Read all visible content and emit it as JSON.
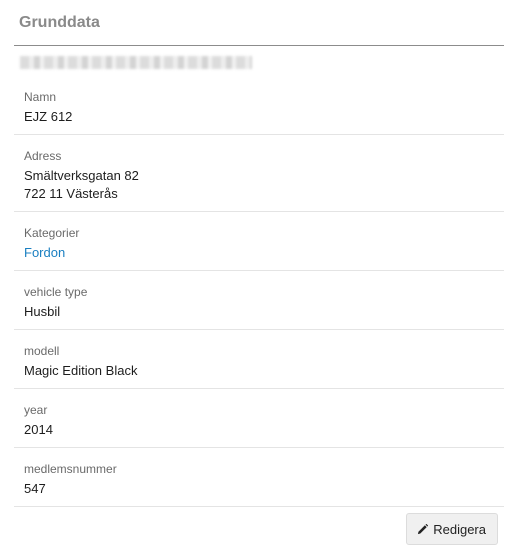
{
  "panel": {
    "title": "Grunddata",
    "blurred_text": "▇▇▇▇▇▇▇▇▇▇▇▇▇▇▇▇▇▇▇▇▇▇▇▇▇▇▇▇▇▇▇▇▇▇▇▇"
  },
  "fields": [
    {
      "label": "Namn",
      "values": [
        "EJZ 612"
      ]
    },
    {
      "label": "Adress",
      "values": [
        "Smältverksgatan 82",
        "722 11 Västerås"
      ]
    },
    {
      "label": "Kategorier",
      "values": [
        "Fordon"
      ],
      "link": true
    },
    {
      "label": "vehicle type",
      "values": [
        "Husbil"
      ]
    },
    {
      "label": "modell",
      "values": [
        "Magic Edition Black"
      ]
    },
    {
      "label": "year",
      "values": [
        "2014"
      ]
    },
    {
      "label": "medlemsnummer",
      "values": [
        "547"
      ]
    }
  ],
  "actions": {
    "edit_label": "Redigera",
    "edit_icon": "pencil-icon"
  },
  "colors": {
    "link": "#1a7fc1",
    "title": "#8a8a8a"
  }
}
